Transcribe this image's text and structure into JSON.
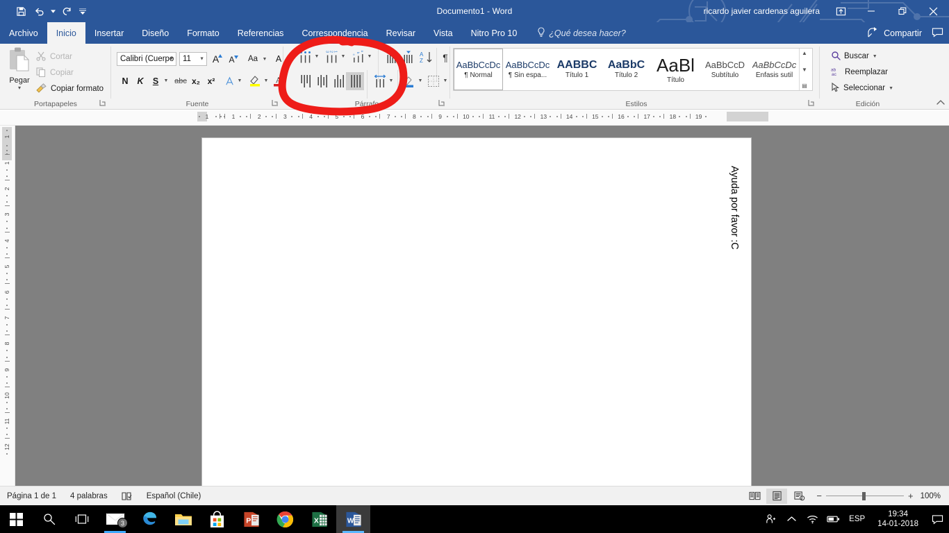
{
  "titlebar": {
    "document_title": "Documento1  -  Word",
    "account_name": "ricardo javier cardenas aguilera",
    "quick_access": [
      {
        "name": "save-icon",
        "label": "Guardar"
      },
      {
        "name": "undo-icon",
        "label": "Deshacer"
      },
      {
        "name": "redo-icon",
        "label": "Rehacer"
      },
      {
        "name": "customize-qat-icon",
        "label": "Personalizar barra de herramientas de acceso rápido"
      }
    ],
    "window_controls": [
      {
        "name": "ribbon-display-options-icon",
        "label": "Opciones de presentación de la cinta de opciones"
      },
      {
        "name": "minimize-icon",
        "label": "Minimizar"
      },
      {
        "name": "restore-icon",
        "label": "Restaurar"
      },
      {
        "name": "close-icon",
        "label": "Cerrar"
      }
    ]
  },
  "tabs": [
    {
      "label": "Archivo",
      "active": false,
      "file": true
    },
    {
      "label": "Inicio",
      "active": true
    },
    {
      "label": "Insertar",
      "active": false
    },
    {
      "label": "Diseño",
      "active": false
    },
    {
      "label": "Formato",
      "active": false
    },
    {
      "label": "Referencias",
      "active": false
    },
    {
      "label": "Correspondencia",
      "active": false
    },
    {
      "label": "Revisar",
      "active": false
    },
    {
      "label": "Vista",
      "active": false
    },
    {
      "label": "Nitro Pro 10",
      "active": false
    }
  ],
  "tell_me": {
    "placeholder": "¿Qué desea hacer?",
    "icon": "lightbulb-icon"
  },
  "share": {
    "label": "Compartir",
    "icon": "share-icon",
    "comments_icon": "comments-icon"
  },
  "ribbon": {
    "groups": [
      {
        "name": "clipboard",
        "label": "Portapapeles"
      },
      {
        "name": "font",
        "label": "Fuente"
      },
      {
        "name": "paragraph",
        "label": "Párrafo"
      },
      {
        "name": "styles",
        "label": "Estilos"
      },
      {
        "name": "editing",
        "label": "Edición"
      }
    ],
    "clipboard": {
      "paste_label": "Pegar",
      "items": [
        {
          "label": "Cortar",
          "icon": "scissors-icon",
          "enabled": false
        },
        {
          "label": "Copiar",
          "icon": "copy-icon",
          "enabled": false
        },
        {
          "label": "Copiar formato",
          "icon": "format-painter-icon",
          "enabled": true
        }
      ]
    },
    "font": {
      "font_name": "Calibri (Cuerpo",
      "font_size": "11",
      "buttons": [
        {
          "label": "N",
          "name": "bold-button"
        },
        {
          "label": "K",
          "name": "italic-button"
        },
        {
          "label": "S",
          "name": "underline-button"
        },
        {
          "label": "abc",
          "name": "strikethrough-button"
        },
        {
          "label": "x₂",
          "name": "subscript-button"
        },
        {
          "label": "x²",
          "name": "superscript-button"
        }
      ],
      "grow_label": "A",
      "shrink_label": "A",
      "case_label": "Aa",
      "clear_label": "A"
    },
    "styles": {
      "items": [
        {
          "preview": "AaBbCcDc",
          "name": "¶ Normal",
          "selected": true
        },
        {
          "preview": "AaBbCcDc",
          "name": "¶ Sin espa...",
          "selected": false
        },
        {
          "preview": "AABBC",
          "name": "Título 1",
          "selected": false
        },
        {
          "preview": "AaBbC",
          "name": "Título 2",
          "selected": false
        },
        {
          "preview": "AaBl",
          "name": "Título",
          "selected": false
        },
        {
          "preview": "AaBbCcD",
          "name": "Subtítulo",
          "selected": false
        },
        {
          "preview": "AaBbCcDc",
          "name": "Énfasis sutil",
          "selected": false
        }
      ]
    },
    "editing": {
      "items": [
        {
          "label": "Buscar",
          "icon": "search-icon",
          "caret": true
        },
        {
          "label": "Reemplazar",
          "icon": "replace-icon",
          "caret": false
        },
        {
          "label": "Seleccionar",
          "icon": "select-icon",
          "caret": true
        }
      ]
    },
    "collapse_label": "Contraer la cinta de opciones"
  },
  "ruler": {
    "horizontal_ticks": [
      "1",
      "1",
      "2",
      "3",
      "4",
      "5",
      "6",
      "7",
      "8",
      "9",
      "10",
      "11",
      "12",
      "13",
      "14",
      "15",
      "16",
      "17",
      "18",
      "19"
    ],
    "vertical_ticks": [
      "1",
      "1",
      "2",
      "3",
      "4",
      "5",
      "6",
      "7",
      "8",
      "9",
      "10",
      "11",
      "12"
    ]
  },
  "document": {
    "text": "Ayuda por favor :C"
  },
  "statusbar": {
    "page": "Página 1 de 1",
    "words": "4 palabras",
    "proofing_icon": "proofing-icon",
    "language": "Español (Chile)",
    "views": [
      {
        "name": "read-mode-button",
        "label": "Modo de lectura",
        "active": false
      },
      {
        "name": "print-layout-button",
        "label": "Diseño de impresión",
        "active": true
      },
      {
        "name": "web-layout-button",
        "label": "Diseño web",
        "active": false
      }
    ],
    "zoom_out": "−",
    "zoom_in": "+",
    "zoom_value": "100%"
  },
  "taskbar": {
    "system_buttons": [
      {
        "name": "start-button",
        "label": "Inicio"
      },
      {
        "name": "search-button",
        "label": "Buscar"
      },
      {
        "name": "task-view-button",
        "label": "Vista de tareas"
      }
    ],
    "apps": [
      {
        "name": "mail-app",
        "label": "Correo",
        "badge": "3"
      },
      {
        "name": "edge-app",
        "label": "Microsoft Edge",
        "badge": ""
      },
      {
        "name": "file-explorer-app",
        "label": "Explorador de archivos",
        "badge": ""
      },
      {
        "name": "store-app",
        "label": "Microsoft Store",
        "badge": ""
      },
      {
        "name": "powerpoint-app",
        "label": "PowerPoint",
        "badge": ""
      },
      {
        "name": "chrome-app",
        "label": "Google Chrome",
        "badge": ""
      },
      {
        "name": "excel-app",
        "label": "Excel",
        "badge": ""
      },
      {
        "name": "word-app",
        "label": "Word",
        "badge": ""
      }
    ],
    "tray": {
      "icons": [
        {
          "name": "people-icon",
          "label": "Contactos"
        },
        {
          "name": "show-hidden-icons-icon",
          "label": "Mostrar iconos ocultos"
        },
        {
          "name": "wifi-icon",
          "label": "Red"
        },
        {
          "name": "battery-icon",
          "label": "Batería"
        }
      ],
      "language": "ESP",
      "time": "19:34",
      "date": "14-01-2018",
      "action_center_icon": "action-center-icon"
    }
  },
  "annotation": {
    "shape": "hand-drawn-red-ellipse",
    "color": "#ee1c18",
    "target": "Párrafo"
  },
  "colors": {
    "word_blue": "#2b579a",
    "ribbon_bg": "#f3f3f3",
    "annotation_red": "#ee1c18"
  }
}
